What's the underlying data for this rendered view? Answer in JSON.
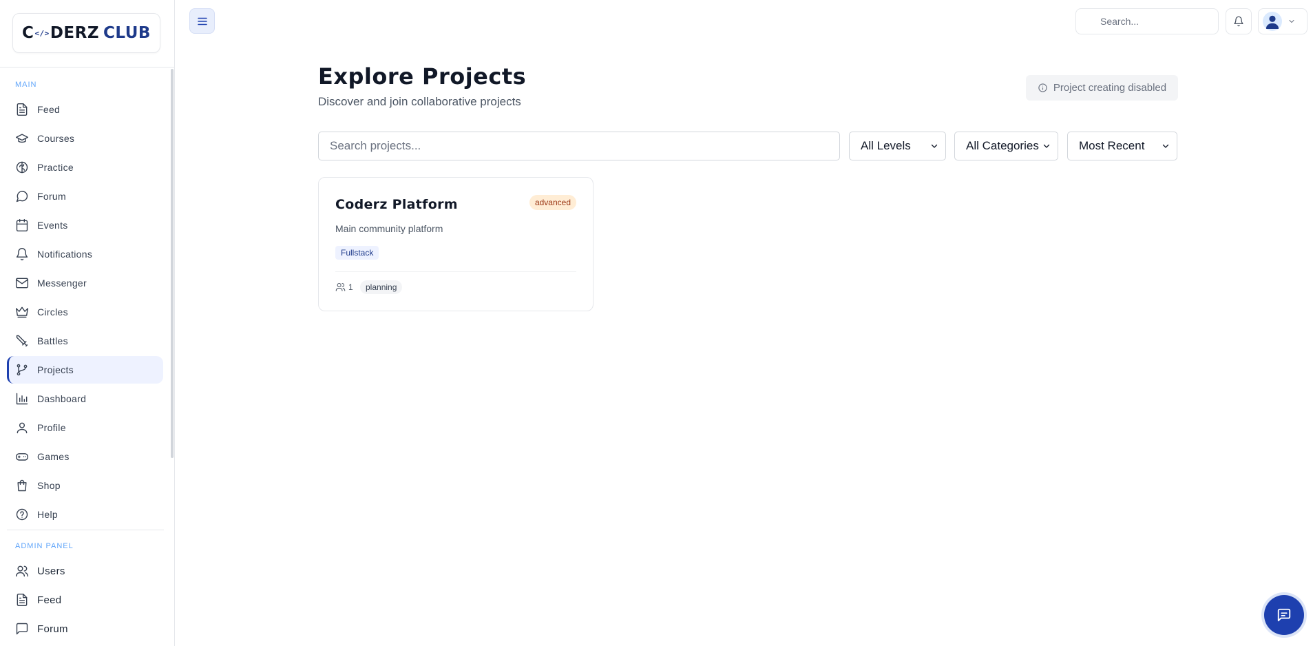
{
  "brand": {
    "logo_left": "C",
    "logo_mark": "</>",
    "logo_mid": "DERZ",
    "logo_right": "CLUB"
  },
  "sidebar": {
    "main_label": "MAIN",
    "admin_label": "ADMIN PANEL",
    "items": [
      {
        "label": "Feed",
        "icon": "file-text-icon"
      },
      {
        "label": "Courses",
        "icon": "graduation-cap-icon"
      },
      {
        "label": "Practice",
        "icon": "brain-icon"
      },
      {
        "label": "Forum",
        "icon": "message-circle-icon"
      },
      {
        "label": "Events",
        "icon": "calendar-icon"
      },
      {
        "label": "Notifications",
        "icon": "bell-icon"
      },
      {
        "label": "Messenger",
        "icon": "mail-icon"
      },
      {
        "label": "Circles",
        "icon": "crown-icon"
      },
      {
        "label": "Battles",
        "icon": "sword-icon"
      },
      {
        "label": "Projects",
        "icon": "git-branch-icon",
        "active": true
      },
      {
        "label": "Dashboard",
        "icon": "bar-chart-icon"
      },
      {
        "label": "Profile",
        "icon": "user-icon"
      },
      {
        "label": "Games",
        "icon": "gamepad-icon"
      },
      {
        "label": "Shop",
        "icon": "shopping-bag-icon"
      },
      {
        "label": "Help",
        "icon": "help-circle-icon"
      }
    ],
    "admin_items": [
      {
        "label": "Users",
        "icon": "users-icon"
      },
      {
        "label": "Feed",
        "icon": "file-text-icon"
      },
      {
        "label": "Forum",
        "icon": "message-square-icon"
      }
    ]
  },
  "topbar": {
    "search_placeholder": "Search..."
  },
  "main": {
    "title": "Explore Projects",
    "subtitle": "Discover and join collaborative projects",
    "disabled_note": "Project creating disabled",
    "search_placeholder": "Search projects...",
    "filters": {
      "level": "All Levels",
      "category": "All Categories",
      "sort": "Most Recent"
    },
    "projects": [
      {
        "title": "Coderz Platform",
        "level": "advanced",
        "description": "Main community platform",
        "tag": "Fullstack",
        "members": "1",
        "status": "planning"
      }
    ]
  },
  "colors": {
    "accent": "#1e40af",
    "active_bg": "#eef2ff",
    "badge_orange_bg": "#ffedd5",
    "badge_orange_text": "#9a3412"
  }
}
